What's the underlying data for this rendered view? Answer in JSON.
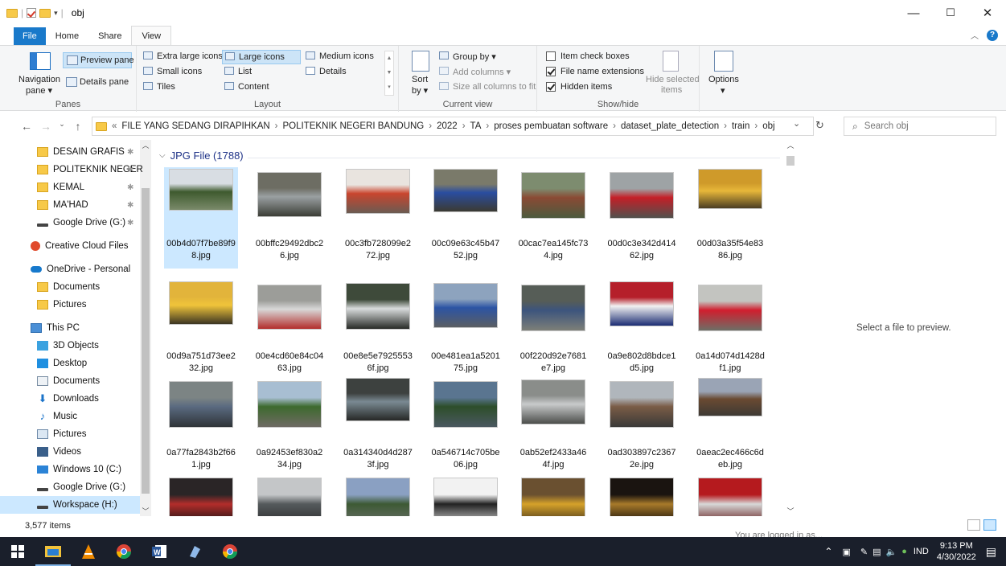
{
  "window": {
    "title": "obj",
    "controls": {
      "minimize": "—",
      "maximize": "☐",
      "close": "✕"
    }
  },
  "tabs": [
    {
      "label": "File"
    },
    {
      "label": "Home"
    },
    {
      "label": "Share"
    },
    {
      "label": "View",
      "active": true
    }
  ],
  "ribbon": {
    "panes": {
      "label": "Panes",
      "navigation_pane": "Navigation pane",
      "navigation_pane_line1": "Navigation",
      "navigation_pane_line2": "pane ▾",
      "preview_pane": "Preview pane",
      "details_pane": "Details pane"
    },
    "layout": {
      "label": "Layout",
      "extra_large_icons": "Extra large icons",
      "large_icons": "Large icons",
      "medium_icons": "Medium icons",
      "small_icons": "Small icons",
      "list": "List",
      "details": "Details",
      "tiles": "Tiles",
      "content": "Content",
      "selected": "Large icons"
    },
    "current_view": {
      "label": "Current view",
      "sort_by_line1": "Sort",
      "sort_by_line2": "by ▾",
      "group_by": "Group by ▾",
      "add_columns": "Add columns ▾",
      "size_all_columns": "Size all columns to fit"
    },
    "show_hide": {
      "label": "Show/hide",
      "item_check_boxes": {
        "label": "Item check boxes",
        "checked": false
      },
      "file_name_extensions": {
        "label": "File name extensions",
        "checked": true
      },
      "hidden_items": {
        "label": "Hidden items",
        "checked": true
      },
      "hide_selected_items_line1": "Hide selected",
      "hide_selected_items_line2": "items"
    },
    "options": {
      "label": "Options",
      "arrow": "▾"
    }
  },
  "address": {
    "prefix": "«",
    "crumbs": [
      "FILE YANG SEDANG DIRAPIHKAN",
      "POLITEKNIK NEGERI BANDUNG",
      "2022",
      "TA",
      "proses pembuatan software",
      "dataset_plate_detection",
      "train",
      "obj"
    ],
    "separator": "›",
    "search_placeholder": "Search obj"
  },
  "nav_pane": {
    "items": [
      {
        "label": "DESAIN GRAFIS",
        "icon": "folder-icon",
        "pinned": true
      },
      {
        "label": "POLITEKNIK NEGER",
        "icon": "folder-icon",
        "pinned": true
      },
      {
        "label": "KEMAL",
        "icon": "folder-icon",
        "pinned": true
      },
      {
        "label": "MA'HAD",
        "icon": "folder-icon",
        "pinned": true
      },
      {
        "label": "Google Drive (G:)",
        "icon": "drive-icon",
        "pinned": true
      },
      {
        "label": "Creative Cloud Files",
        "icon": "creative-cloud-icon"
      },
      {
        "label": "OneDrive - Personal",
        "icon": "onedrive-icon"
      },
      {
        "label": "Documents",
        "icon": "folder-icon"
      },
      {
        "label": "Pictures",
        "icon": "folder-icon"
      },
      {
        "label": "This PC",
        "icon": "this-pc-icon"
      },
      {
        "label": "3D Objects",
        "icon": "3d-objects-icon"
      },
      {
        "label": "Desktop",
        "icon": "desktop-icon"
      },
      {
        "label": "Documents",
        "icon": "documents-icon"
      },
      {
        "label": "Downloads",
        "icon": "downloads-icon"
      },
      {
        "label": "Music",
        "icon": "music-icon"
      },
      {
        "label": "Pictures",
        "icon": "pictures-icon"
      },
      {
        "label": "Videos",
        "icon": "videos-icon"
      },
      {
        "label": "Windows 10 (C:)",
        "icon": "windows-drive-icon"
      },
      {
        "label": "Google Drive (G:)",
        "icon": "drive-icon"
      },
      {
        "label": "Workspace (H:)",
        "icon": "drive-icon",
        "selected": true
      }
    ]
  },
  "content": {
    "group_header": "JPG File (1788)",
    "files": [
      {
        "name": "00b4d07f7be89f98.jpg",
        "colors": [
          "#d8dde3",
          "#3e5a2e",
          "#7a8a6a"
        ],
        "selected": true
      },
      {
        "name": "00bffc29492dbc26.jpg",
        "colors": [
          "#6d6d63",
          "#9aa0a2",
          "#3b3d36"
        ]
      },
      {
        "name": "00c3fb728099e272.jpg",
        "colors": [
          "#e9e4df",
          "#c9452e",
          "#6a5b52"
        ]
      },
      {
        "name": "00c09e63c45b4752.jpg",
        "colors": [
          "#7a7a6a",
          "#2a4da0",
          "#3b3a32"
        ]
      },
      {
        "name": "00cac7ea145fc734.jpg",
        "colors": [
          "#7d8c6f",
          "#8a4a34",
          "#4c5a3e"
        ]
      },
      {
        "name": "00d0c3e342d41462.jpg",
        "colors": [
          "#9ea3a5",
          "#c41f27",
          "#51514d"
        ]
      },
      {
        "name": "00d03a35f54e8386.jpg",
        "colors": [
          "#cf9a2a",
          "#e7b73a",
          "#4a3d22"
        ]
      },
      {
        "name": "00d9a751d73ee232.jpg",
        "colors": [
          "#e2b43b",
          "#f0c43a",
          "#3b3523"
        ]
      },
      {
        "name": "00e4cd60e84c0463.jpg",
        "colors": [
          "#9c9d99",
          "#d8d8d8",
          "#b32d2b"
        ]
      },
      {
        "name": "00e8e5e79255536f.jpg",
        "colors": [
          "#3e4a3a",
          "#d9dcdd",
          "#272a26"
        ]
      },
      {
        "name": "00e481ea1a520175.jpg",
        "colors": [
          "#8da3be",
          "#2c54a4",
          "#5b5e62"
        ]
      },
      {
        "name": "00f220d92e7681e7.jpg",
        "colors": [
          "#565d57",
          "#3c547d",
          "#7d7f78"
        ]
      },
      {
        "name": "0a9e802d8bdce1d5.jpg",
        "colors": [
          "#b51f2a",
          "#f2f2f2",
          "#1b2c73"
        ]
      },
      {
        "name": "0a14d074d1428df1.jpg",
        "colors": [
          "#c3c4c0",
          "#d11e2e",
          "#6d6f66"
        ]
      },
      {
        "name": "0a77fa2843b2f661.jpg",
        "colors": [
          "#7c8484",
          "#5a6a80",
          "#2f3438"
        ]
      },
      {
        "name": "0a92453ef830a234.jpg",
        "colors": [
          "#a8bed2",
          "#3d6a2e",
          "#6e6a63"
        ]
      },
      {
        "name": "0a314340d4d2873f.jpg",
        "colors": [
          "#3d413f",
          "#7a8a93",
          "#262826"
        ]
      },
      {
        "name": "0a546714c705be06.jpg",
        "colors": [
          "#5a7590",
          "#2d4e2a",
          "#4a5860"
        ]
      },
      {
        "name": "0ab52ef2433a464f.jpg",
        "colors": [
          "#8a8d8a",
          "#c8cacb",
          "#4c4e4b"
        ]
      },
      {
        "name": "0ad303897c23672e.jpg",
        "colors": [
          "#b0b6bc",
          "#7a5c46",
          "#3a3a38"
        ]
      },
      {
        "name": "0aeac2ec466c6deb.jpg",
        "colors": [
          "#9aa4b5",
          "#6a4a32",
          "#3e3a34"
        ]
      },
      {
        "name": "",
        "colors": [
          "#2a2526",
          "#b32d2b",
          "#111"
        ]
      },
      {
        "name": "",
        "colors": [
          "#c4c6c8",
          "#555a5c",
          "#2b2d2e"
        ]
      },
      {
        "name": "",
        "colors": [
          "#8aa0c2",
          "#3d5a34",
          "#6a6e6a"
        ]
      },
      {
        "name": "",
        "colors": [
          "#f2f2f2",
          "#222",
          "#d0d0d0"
        ]
      },
      {
        "name": "",
        "colors": [
          "#6a5030",
          "#d6a22a",
          "#3a2c1a"
        ]
      },
      {
        "name": "",
        "colors": [
          "#1a1410",
          "#a87a2a",
          "#0a0806"
        ]
      },
      {
        "name": "",
        "colors": [
          "#b51a1e",
          "#d8d8d8",
          "#5a1010"
        ]
      }
    ]
  },
  "preview": {
    "text": "Select a file to preview."
  },
  "status": {
    "item_count": "3,577 items",
    "chat_strip": "You are logged in as..."
  },
  "taskbar": {
    "apps": [
      "start-icon",
      "file-explorer-icon",
      "vlc-icon",
      "chrome-icon",
      "word-icon",
      "app-icon",
      "chrome-icon"
    ],
    "tray": {
      "language": "IND",
      "time": "9:13 PM",
      "date": "4/30/2022"
    }
  }
}
